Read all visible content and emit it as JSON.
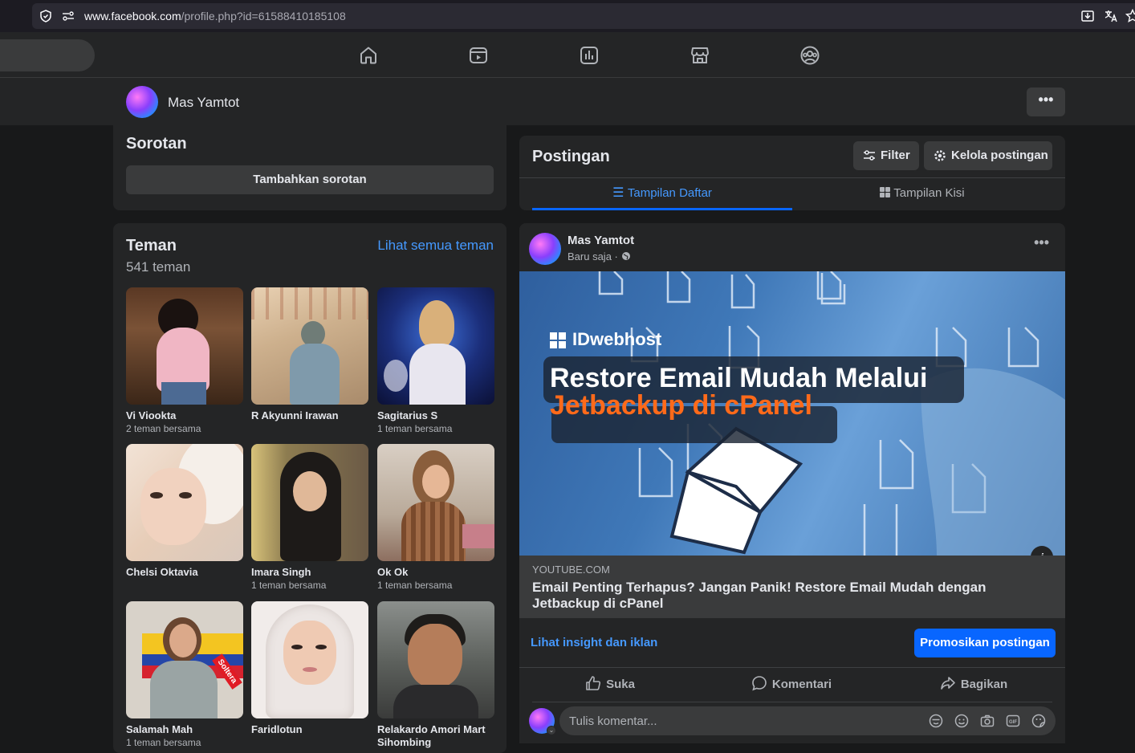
{
  "browser": {
    "url_host": "www.facebook.com",
    "url_path": "/profile.php?id=61588410185108"
  },
  "profile": {
    "name": "Mas Yamtot",
    "more_label": "•••"
  },
  "sorotan": {
    "title": "Sorotan",
    "add_button": "Tambahkan sorotan"
  },
  "teman": {
    "title": "Teman",
    "count": "541 teman",
    "see_all": "Lihat semua teman",
    "friends": [
      {
        "name": "Vi Viookta",
        "mutual": "2 teman bersama"
      },
      {
        "name": "R Akyunni Irawan",
        "mutual": ""
      },
      {
        "name": "Sagitarius S",
        "mutual": "1 teman bersama"
      },
      {
        "name": "Chelsi Oktavia",
        "mutual": ""
      },
      {
        "name": "Imara Singh",
        "mutual": "1 teman bersama"
      },
      {
        "name": "Ok Ok",
        "mutual": "1 teman bersama"
      },
      {
        "name": "Salamah Mah",
        "mutual": "1 teman bersama"
      },
      {
        "name": "Faridlotun",
        "mutual": ""
      },
      {
        "name": "Relakardo Amori Mart Sihombing",
        "mutual": ""
      }
    ],
    "flag_text": "Soltera"
  },
  "postingan": {
    "title": "Postingan",
    "filter": "Filter",
    "manage": "Kelola postingan",
    "tab_list": "Tampilan Daftar",
    "tab_grid": "Tampilan Kisi"
  },
  "post": {
    "author": "Mas Yamtot",
    "time": "Baru saja ·",
    "image": {
      "brand": "IDwebhost",
      "headline1": "Restore Email Mudah Melalui",
      "headline2": "Jetbackup di cPanel"
    },
    "link_domain": "YOUTUBE.COM",
    "link_title": "Email Penting Terhapus? Jangan Panik! Restore Email Mudah dengan Jetbackup di cPanel",
    "insight": "Lihat insight dan iklan",
    "promote": "Promosikan postingan",
    "like": "Suka",
    "comment": "Komentari",
    "share": "Bagikan",
    "comment_placeholder": "Tulis komentar..."
  },
  "colors": {
    "accent": "#0866ff",
    "link": "#4599ff",
    "card": "#242526",
    "page": "#18191a",
    "orange": "#ff6a1a"
  }
}
